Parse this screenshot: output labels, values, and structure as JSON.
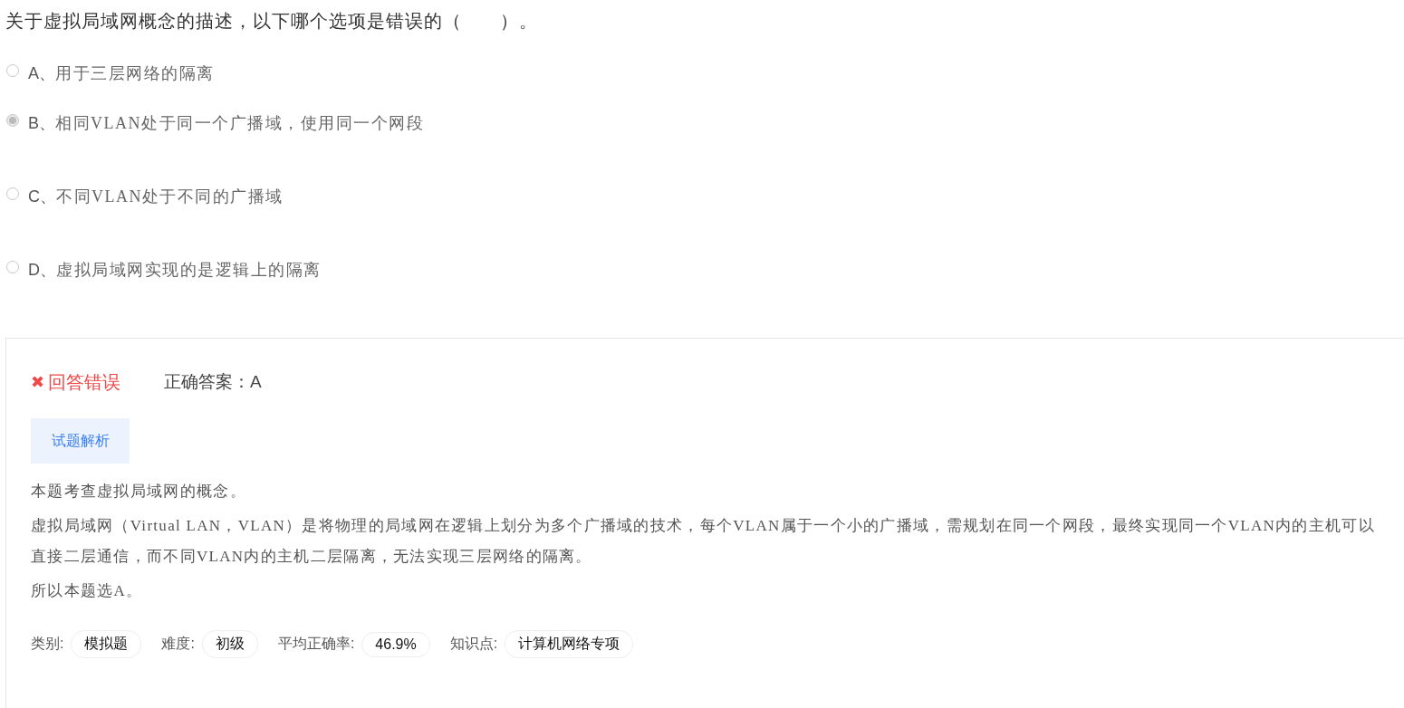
{
  "question": {
    "text": "关于虚拟局域网概念的描述，以下哪个选项是错误的（　　）。"
  },
  "options": [
    {
      "letter": "A、",
      "text": "用于三层网络的隔离",
      "selected": false
    },
    {
      "letter": "B、",
      "text": "相同VLAN处于同一个广播域，使用同一个网段",
      "selected": true
    },
    {
      "letter": "C、",
      "text": "不同VLAN处于不同的广播域",
      "selected": false
    },
    {
      "letter": "D、",
      "text": "虚拟局域网实现的是逻辑上的隔离",
      "selected": false
    }
  ],
  "result": {
    "icon": "✖",
    "status": "回答错误",
    "correct_answer": "正确答案：A"
  },
  "analysis_tab": {
    "label": "试题解析"
  },
  "analysis": [
    "本题考查虚拟局域网的概念。",
    "虚拟局域网（Virtual LAN，VLAN）是将物理的局域网在逻辑上划分为多个广播域的技术，每个VLAN属于一个小的广播域，需规划在同一个网段，最终实现同一个VLAN内的主机可以直接二层通信，而不同VLAN内的主机二层隔离，无法实现三层网络的隔离。",
    "所以本题选A。"
  ],
  "meta": [
    {
      "label": "类别:",
      "value": "模拟题"
    },
    {
      "label": "难度:",
      "value": "初级"
    },
    {
      "label": "平均正确率:",
      "value": "46.9%"
    },
    {
      "label": "知识点:",
      "value": "计算机网络专项"
    }
  ]
}
